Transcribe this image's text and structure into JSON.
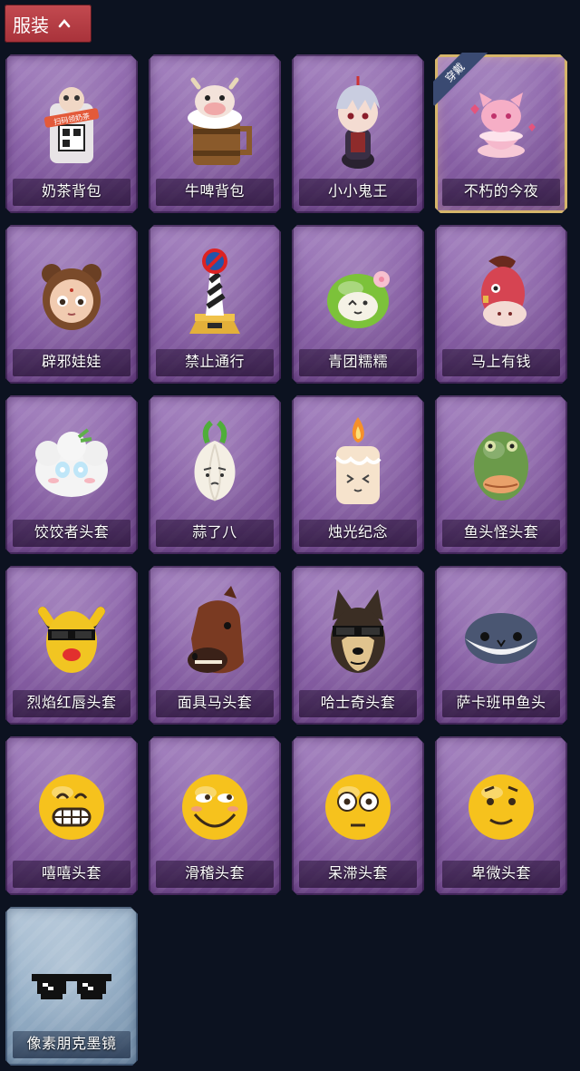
{
  "header": {
    "title": "服装"
  },
  "equipped_tag": "穿戴",
  "items": [
    {
      "label": "奶茶背包",
      "icon": "milk-tea-backpack-icon",
      "equipped": false,
      "rarity": "purple",
      "qr_text": "扫码领奶茶"
    },
    {
      "label": "牛啤背包",
      "icon": "cow-beer-backpack-icon",
      "equipped": false,
      "rarity": "purple"
    },
    {
      "label": "小小鬼王",
      "icon": "little-ghost-king-icon",
      "equipped": false,
      "rarity": "purple"
    },
    {
      "label": "不朽的今夜",
      "icon": "immortal-tonight-icon",
      "equipped": true,
      "rarity": "purple"
    },
    {
      "label": "辟邪娃娃",
      "icon": "talisman-doll-icon",
      "equipped": false,
      "rarity": "purple"
    },
    {
      "label": "禁止通行",
      "icon": "no-entry-sign-icon",
      "equipped": false,
      "rarity": "purple"
    },
    {
      "label": "青团糯糯",
      "icon": "green-rice-ball-icon",
      "equipped": false,
      "rarity": "purple"
    },
    {
      "label": "马上有钱",
      "icon": "lucky-horse-icon",
      "equipped": false,
      "rarity": "purple"
    },
    {
      "label": "饺饺者头套",
      "icon": "dumpling-headgear-icon",
      "equipped": false,
      "rarity": "purple"
    },
    {
      "label": "蒜了八",
      "icon": "garlic-icon",
      "equipped": false,
      "rarity": "purple"
    },
    {
      "label": "烛光纪念",
      "icon": "candle-icon",
      "equipped": false,
      "rarity": "purple"
    },
    {
      "label": "鱼头怪头套",
      "icon": "fish-head-mask-icon",
      "equipped": false,
      "rarity": "purple"
    },
    {
      "label": "烈焰红唇头套",
      "icon": "red-lips-mask-icon",
      "equipped": false,
      "rarity": "purple"
    },
    {
      "label": "面具马头套",
      "icon": "horse-mask-icon",
      "equipped": false,
      "rarity": "purple"
    },
    {
      "label": "哈士奇头套",
      "icon": "husky-mask-icon",
      "equipped": false,
      "rarity": "purple"
    },
    {
      "label": "萨卡班甲鱼头",
      "icon": "sacabambaspis-head-icon",
      "equipped": false,
      "rarity": "purple"
    },
    {
      "label": "嘻嘻头套",
      "icon": "grin-emoji-icon",
      "equipped": false,
      "rarity": "purple"
    },
    {
      "label": "滑稽头套",
      "icon": "funny-emoji-icon",
      "equipped": false,
      "rarity": "purple"
    },
    {
      "label": "呆滞头套",
      "icon": "dazed-emoji-icon",
      "equipped": false,
      "rarity": "purple"
    },
    {
      "label": "卑微头套",
      "icon": "humble-emoji-icon",
      "equipped": false,
      "rarity": "purple"
    },
    {
      "label": "像素朋克墨镜",
      "icon": "pixel-sunglasses-icon",
      "equipped": false,
      "rarity": "blue"
    }
  ]
}
